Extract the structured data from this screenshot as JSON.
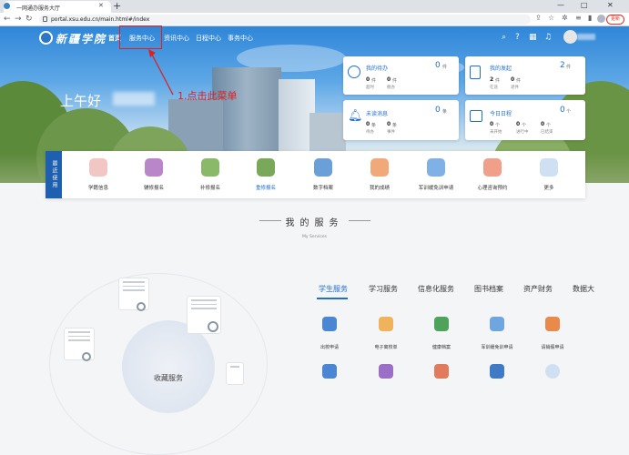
{
  "browser": {
    "tab_title": "一网通办服务大厅",
    "url": "portal.xsu.edu.cn/main.html#/index",
    "update_label": "更新",
    "window_controls": [
      "—",
      "□",
      "✕"
    ]
  },
  "header": {
    "logo_text": "新疆学院",
    "nav": [
      "首页",
      "服务中心",
      "资讯中心",
      "日程中心",
      "事务中心"
    ],
    "greeting": "上午好",
    "annotation": "1.点击此菜单",
    "icons": [
      "search-icon",
      "help-icon",
      "grid-icon",
      "bell-icon"
    ]
  },
  "cards": {
    "todo": {
      "title": "我的待办",
      "count": "0",
      "unit": "件",
      "stats": [
        {
          "num": "0",
          "unit": "件",
          "label": "超时"
        },
        {
          "num": "0",
          "unit": "件",
          "label": "催办"
        }
      ]
    },
    "apply": {
      "title": "我的发起",
      "count": "2",
      "unit": "件",
      "stats": [
        {
          "num": "2",
          "unit": "件",
          "label": "在途"
        },
        {
          "num": "0",
          "unit": "件",
          "label": "退件"
        }
      ]
    },
    "msg": {
      "title": "未读消息",
      "count": "0",
      "unit": "条",
      "stats": [
        {
          "num": "0",
          "unit": "条",
          "label": "待办"
        },
        {
          "num": "0",
          "unit": "条",
          "label": "事件"
        }
      ]
    },
    "sched": {
      "title": "今日日程",
      "count": "0",
      "unit": "个",
      "stats": [
        {
          "num": "0",
          "unit": "个",
          "label": "未开始"
        },
        {
          "num": "0",
          "unit": "个",
          "label": "进行中"
        },
        {
          "num": "0",
          "unit": "个",
          "label": "已结束"
        }
      ]
    }
  },
  "recent": {
    "label": "最近使用",
    "items": [
      {
        "label": "学籍信息",
        "color": "#f3c6c6"
      },
      {
        "label": "辅修报名",
        "color": "#b986c9"
      },
      {
        "label": "补修报名",
        "color": "#8bb96a"
      },
      {
        "label": "重修报名",
        "color": "#7aa85a"
      },
      {
        "label": "数字档案",
        "color": "#6a9fd8"
      },
      {
        "label": "我的成绩",
        "color": "#f2a97a"
      },
      {
        "label": "军训缓免训申请",
        "color": "#7fb0e6"
      },
      {
        "label": "心理咨询预约",
        "color": "#f0a08a"
      },
      {
        "label": "更多",
        "color": "#cfe0f2"
      }
    ]
  },
  "services": {
    "title": "我的服务",
    "subtitle": "My Services",
    "tabs": [
      "学生服务",
      "学习服务",
      "信息化服务",
      "图书档案",
      "资产财务",
      "数据大"
    ],
    "row1": [
      {
        "label": "出校申请",
        "color": "#4a86d1"
      },
      {
        "label": "电子离校单",
        "color": "#f0b25a"
      },
      {
        "label": "健康档案",
        "color": "#4fa25a"
      },
      {
        "label": "军训缓免训申请",
        "color": "#6fa6e0"
      },
      {
        "label": "请销假申请",
        "color": "#e98a4a"
      }
    ],
    "row2": [
      {
        "color": "#4a86d1"
      },
      {
        "color": "#9b6fc6"
      },
      {
        "color": "#e27b5b"
      },
      {
        "color": "#3f7ac7"
      },
      {
        "color": "#cfe0f2"
      }
    ],
    "collect_label": "收藏服务"
  }
}
